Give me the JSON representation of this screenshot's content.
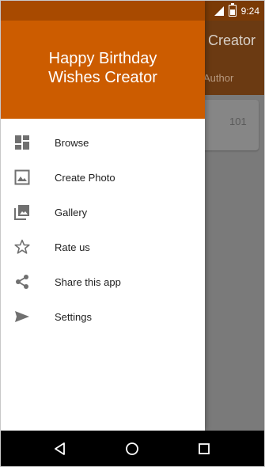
{
  "status_bar": {
    "time": "9:24"
  },
  "background_app": {
    "title": "Creator",
    "tab_label": "Author",
    "card_count": "101"
  },
  "drawer": {
    "title": "Happy Birthday\nWishes Creator",
    "items": [
      {
        "label": "Browse",
        "icon": "dashboard-icon"
      },
      {
        "label": "Create Photo",
        "icon": "image-icon"
      },
      {
        "label": "Gallery",
        "icon": "photo-library-icon"
      },
      {
        "label": "Rate us",
        "icon": "star-outline-icon"
      },
      {
        "label": "Share this app",
        "icon": "share-icon"
      },
      {
        "label": "Settings",
        "icon": "send-icon"
      }
    ]
  },
  "colors": {
    "header": "#cc5c00",
    "status": "#a84a00",
    "icon": "#707070"
  }
}
